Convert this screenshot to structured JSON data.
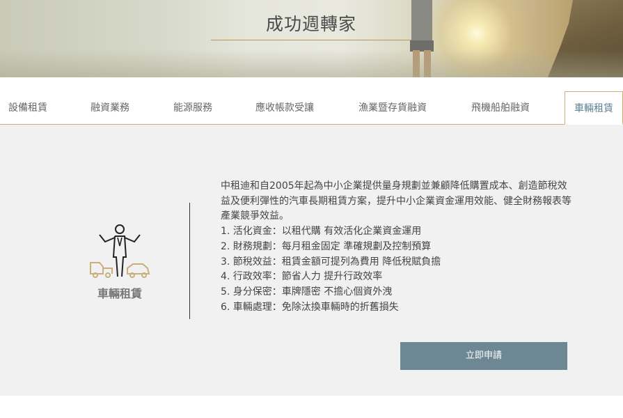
{
  "hero": {
    "title": "成功週轉家"
  },
  "tabs": [
    {
      "label": "設備租賃",
      "active": false
    },
    {
      "label": "融資業務",
      "active": false
    },
    {
      "label": "能源服務",
      "active": false
    },
    {
      "label": "應收帳款受讓",
      "active": false
    },
    {
      "label": "漁業暨存貨融資",
      "active": false
    },
    {
      "label": "飛機船舶融資",
      "active": false
    },
    {
      "label": "車輛租賃",
      "active": true
    }
  ],
  "service": {
    "icon": "person-with-cars-icon",
    "label": "車輛租賃",
    "intro": "中租迪和自2005年起為中小企業提供量身規劃並兼顧降低購置成本、創造節稅效益及便利彈性的汽車長期租賃方案，提升中小企業資金運用效能、健全財務報表等產業競爭效益。",
    "points": [
      "1. 活化資金：以租代購 有效活化企業資金運用",
      "2. 財務規劃：每月租金固定 準確規劃及控制預算",
      "3. 節稅效益：租賃金額可提列為費用 降低稅賦負擔",
      "4. 行政效率：節省人力 提升行政效率",
      "5. 身分保密：車牌隱密 不擔心個資外洩",
      "6. 車輛處理：免除汰換車輛時的折舊損失"
    ],
    "apply_label": "立即申請"
  },
  "colors": {
    "accent_gold": "#b59a48",
    "button": "#6e8794",
    "active_tab_text": "#5c7f95",
    "panel_bg": "#f1f1f1"
  }
}
